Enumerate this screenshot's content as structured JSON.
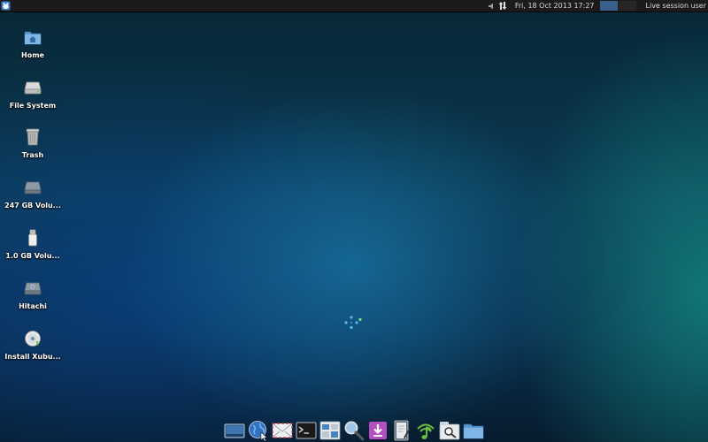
{
  "top_panel": {
    "menu_icon": "xfce-mouse-icon",
    "tray_icons": [
      "volume-icon",
      "network-updown-icon"
    ],
    "clock": "Fri, 18 Oct 2013 17:27",
    "workspaces": [
      "workspace-1",
      "workspace-2"
    ],
    "user_menu": "Live session user"
  },
  "desktop_icons": [
    {
      "label": "Home",
      "icon": "home-folder-icon"
    },
    {
      "label": "File System",
      "icon": "drive-icon"
    },
    {
      "label": "Trash",
      "icon": "trash-icon"
    },
    {
      "label": "247 GB Volu...",
      "icon": "harddisk-icon"
    },
    {
      "label": "1.0 GB Volu...",
      "icon": "usb-drive-icon"
    },
    {
      "label": "Hitachi",
      "icon": "harddisk-icon"
    },
    {
      "label": "Install Xubu...",
      "icon": "cd-installer-icon"
    }
  ],
  "dock_items": [
    "show-desktop-icon",
    "web-browser-icon",
    "mail-icon",
    "terminal-icon",
    "settings-manager-icon",
    "search-icon",
    "software-center-icon",
    "text-editor-icon",
    "music-player-icon",
    "app-finder-icon",
    "file-manager-icon"
  ],
  "colors": {
    "panel_bg": "#1b1b1b",
    "active_workspace": "#3a5f8d",
    "folder_blue": "#5b9bd5"
  }
}
